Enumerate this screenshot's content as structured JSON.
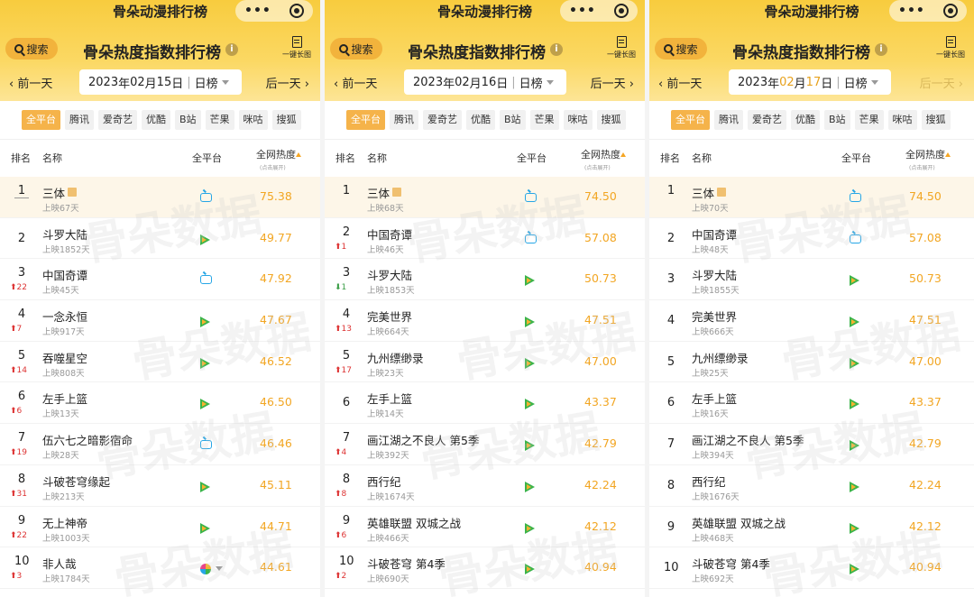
{
  "app_title": "骨朵动漫排行榜",
  "capsule_dots": "•••",
  "search_label": "搜索",
  "main_title": "骨朵热度指数排行榜",
  "info_glyph": "i",
  "long_image_label": "一键长图",
  "prev_label": "‹ 前一天",
  "next_label": "后一天 ›",
  "list_type": "日榜",
  "platforms": [
    "全平台",
    "腾讯",
    "爱奇艺",
    "优酷",
    "B站",
    "芒果",
    "咪咕",
    "搜狐"
  ],
  "headers": {
    "rank": "排名",
    "name": "名称",
    "platform": "全平台",
    "heat": "全网热度",
    "heat_sub": "(点击展开)"
  },
  "watermark": "骨朵数据",
  "colors": {
    "accent": "#f5b34a",
    "heat": "#f2a623",
    "up": "#dd3333",
    "down": "#3b9e47"
  },
  "panels": [
    {
      "date": {
        "year": "2023",
        "y_unit": "年",
        "month": "02",
        "m_unit": "月",
        "day": "15",
        "d_unit": "日"
      },
      "highlight_date": false,
      "next_disabled": false,
      "rows": [
        {
          "rank": "1",
          "change": "",
          "dir": "",
          "name": "三体",
          "tag": true,
          "days": "上映67天",
          "platform": "tv-icon",
          "heat": "75.38"
        },
        {
          "rank": "2",
          "change": "",
          "dir": "",
          "name": "斗罗大陆",
          "tag": false,
          "days": "上映1852天",
          "platform": "play-icon",
          "heat": "49.77"
        },
        {
          "rank": "3",
          "change": "22",
          "dir": "up",
          "name": "中国奇谭",
          "tag": false,
          "days": "上映45天",
          "platform": "tv-icon",
          "heat": "47.92"
        },
        {
          "rank": "4",
          "change": "7",
          "dir": "up",
          "name": "一念永恒",
          "tag": false,
          "days": "上映917天",
          "platform": "play-icon",
          "heat": "47.67"
        },
        {
          "rank": "5",
          "change": "14",
          "dir": "up",
          "name": "吞噬星空",
          "tag": false,
          "days": "上映808天",
          "platform": "play-icon",
          "heat": "46.52"
        },
        {
          "rank": "6",
          "change": "6",
          "dir": "up",
          "name": "左手上篮",
          "tag": false,
          "days": "上映13天",
          "platform": "play-icon",
          "heat": "46.50"
        },
        {
          "rank": "7",
          "change": "19",
          "dir": "up",
          "name": "伍六七之暗影宿命",
          "tag": false,
          "days": "上映28天",
          "platform": "tv-icon",
          "heat": "46.46"
        },
        {
          "rank": "8",
          "change": "31",
          "dir": "up",
          "name": "斗破苍穹缘起",
          "tag": false,
          "days": "上映213天",
          "platform": "play-icon",
          "heat": "45.11"
        },
        {
          "rank": "9",
          "change": "22",
          "dir": "up",
          "name": "无上神帝",
          "tag": false,
          "days": "上映1003天",
          "platform": "play-icon",
          "heat": "44.71"
        },
        {
          "rank": "10",
          "change": "3",
          "dir": "up",
          "name": "非人哉",
          "tag": false,
          "days": "上映1784天",
          "platform": "multi-icon",
          "heat": "44.61"
        }
      ]
    },
    {
      "date": {
        "year": "2023",
        "y_unit": "年",
        "month": "02",
        "m_unit": "月",
        "day": "16",
        "d_unit": "日"
      },
      "highlight_date": false,
      "next_disabled": false,
      "rows": [
        {
          "rank": "1",
          "change": "",
          "dir": "",
          "name": "三体",
          "tag": true,
          "days": "上映68天",
          "platform": "tv-icon",
          "heat": "74.50"
        },
        {
          "rank": "2",
          "change": "1",
          "dir": "up",
          "name": "中国奇谭",
          "tag": false,
          "days": "上映46天",
          "platform": "tv-icon",
          "heat": "57.08"
        },
        {
          "rank": "3",
          "change": "1",
          "dir": "down",
          "name": "斗罗大陆",
          "tag": false,
          "days": "上映1853天",
          "platform": "play-icon",
          "heat": "50.73"
        },
        {
          "rank": "4",
          "change": "13",
          "dir": "up",
          "name": "完美世界",
          "tag": false,
          "days": "上映664天",
          "platform": "play-icon",
          "heat": "47.51"
        },
        {
          "rank": "5",
          "change": "17",
          "dir": "up",
          "name": "九州缥缈录",
          "tag": false,
          "days": "上映23天",
          "platform": "play-icon",
          "heat": "47.00"
        },
        {
          "rank": "6",
          "change": "",
          "dir": "",
          "name": "左手上篮",
          "tag": false,
          "days": "上映14天",
          "platform": "play-icon",
          "heat": "43.37"
        },
        {
          "rank": "7",
          "change": "4",
          "dir": "up",
          "name": "画江湖之不良人 第5季",
          "tag": false,
          "days": "上映392天",
          "platform": "play-icon",
          "heat": "42.79"
        },
        {
          "rank": "8",
          "change": "8",
          "dir": "up",
          "name": "西行纪",
          "tag": false,
          "days": "上映1674天",
          "platform": "play-icon",
          "heat": "42.24"
        },
        {
          "rank": "9",
          "change": "6",
          "dir": "up",
          "name": "英雄联盟 双城之战",
          "tag": false,
          "days": "上映466天",
          "platform": "play-icon",
          "heat": "42.12"
        },
        {
          "rank": "10",
          "change": "2",
          "dir": "up",
          "name": "斗破苍穹 第4季",
          "tag": false,
          "days": "上映690天",
          "platform": "play-icon",
          "heat": "40.94"
        }
      ]
    },
    {
      "date": {
        "year": "2023",
        "y_unit": "年",
        "month": "02",
        "m_unit": "月",
        "day": "17",
        "d_unit": "日"
      },
      "highlight_date": true,
      "next_disabled": true,
      "rows": [
        {
          "rank": "1",
          "change": "",
          "dir": "",
          "name": "三体",
          "tag": true,
          "days": "上映70天",
          "platform": "tv-icon",
          "heat": "74.50"
        },
        {
          "rank": "2",
          "change": "",
          "dir": "",
          "name": "中国奇谭",
          "tag": false,
          "days": "上映48天",
          "platform": "tv-icon",
          "heat": "57.08"
        },
        {
          "rank": "3",
          "change": "",
          "dir": "",
          "name": "斗罗大陆",
          "tag": false,
          "days": "上映1855天",
          "platform": "play-icon",
          "heat": "50.73"
        },
        {
          "rank": "4",
          "change": "",
          "dir": "",
          "name": "完美世界",
          "tag": false,
          "days": "上映666天",
          "platform": "play-icon",
          "heat": "47.51"
        },
        {
          "rank": "5",
          "change": "",
          "dir": "",
          "name": "九州缥缈录",
          "tag": false,
          "days": "上映25天",
          "platform": "play-icon",
          "heat": "47.00"
        },
        {
          "rank": "6",
          "change": "",
          "dir": "",
          "name": "左手上篮",
          "tag": false,
          "days": "上映16天",
          "platform": "play-icon",
          "heat": "43.37"
        },
        {
          "rank": "7",
          "change": "",
          "dir": "",
          "name": "画江湖之不良人 第5季",
          "tag": false,
          "days": "上映394天",
          "platform": "play-icon",
          "heat": "42.79"
        },
        {
          "rank": "8",
          "change": "",
          "dir": "",
          "name": "西行纪",
          "tag": false,
          "days": "上映1676天",
          "platform": "play-icon",
          "heat": "42.24"
        },
        {
          "rank": "9",
          "change": "",
          "dir": "",
          "name": "英雄联盟 双城之战",
          "tag": false,
          "days": "上映468天",
          "platform": "play-icon",
          "heat": "42.12"
        },
        {
          "rank": "10",
          "change": "",
          "dir": "",
          "name": "斗破苍穹 第4季",
          "tag": false,
          "days": "上映692天",
          "platform": "play-icon",
          "heat": "40.94"
        }
      ]
    }
  ]
}
